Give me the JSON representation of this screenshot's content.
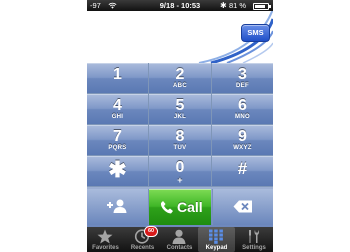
{
  "status_bar": {
    "signal": "-97",
    "time": "9/18 - 10:53",
    "battery_pct": "81 %",
    "battery_level": 0.81
  },
  "display": {
    "number": "",
    "sms_label": "SMS"
  },
  "keypad": [
    {
      "digit": "1",
      "letters": ""
    },
    {
      "digit": "2",
      "letters": "ABC"
    },
    {
      "digit": "3",
      "letters": "DEF"
    },
    {
      "digit": "4",
      "letters": "GHI"
    },
    {
      "digit": "5",
      "letters": "JKL"
    },
    {
      "digit": "6",
      "letters": "MNO"
    },
    {
      "digit": "7",
      "letters": "PQRS"
    },
    {
      "digit": "8",
      "letters": "TUV"
    },
    {
      "digit": "9",
      "letters": "WXYZ"
    },
    {
      "digit": "✱",
      "letters": ""
    },
    {
      "digit": "0",
      "letters": "+"
    },
    {
      "digit": "#",
      "letters": ""
    }
  ],
  "actions": {
    "call_label": "Call",
    "add_contact_icon": "add-contact-icon",
    "delete_icon": "backspace-icon",
    "call_color": "#2ea11a"
  },
  "tabbar": {
    "tabs": [
      {
        "label": "Favorites",
        "icon": "star-icon"
      },
      {
        "label": "Recents",
        "icon": "clock-icon",
        "badge": "60"
      },
      {
        "label": "Contacts",
        "icon": "person-icon"
      },
      {
        "label": "Keypad",
        "icon": "keypad-icon"
      },
      {
        "label": "Settings",
        "icon": "settings-icon"
      }
    ],
    "active": "Keypad"
  },
  "colors": {
    "key_blue": "#6b87bd",
    "sms_blue": "#1f4fc8",
    "badge_red": "#d71a1a"
  }
}
